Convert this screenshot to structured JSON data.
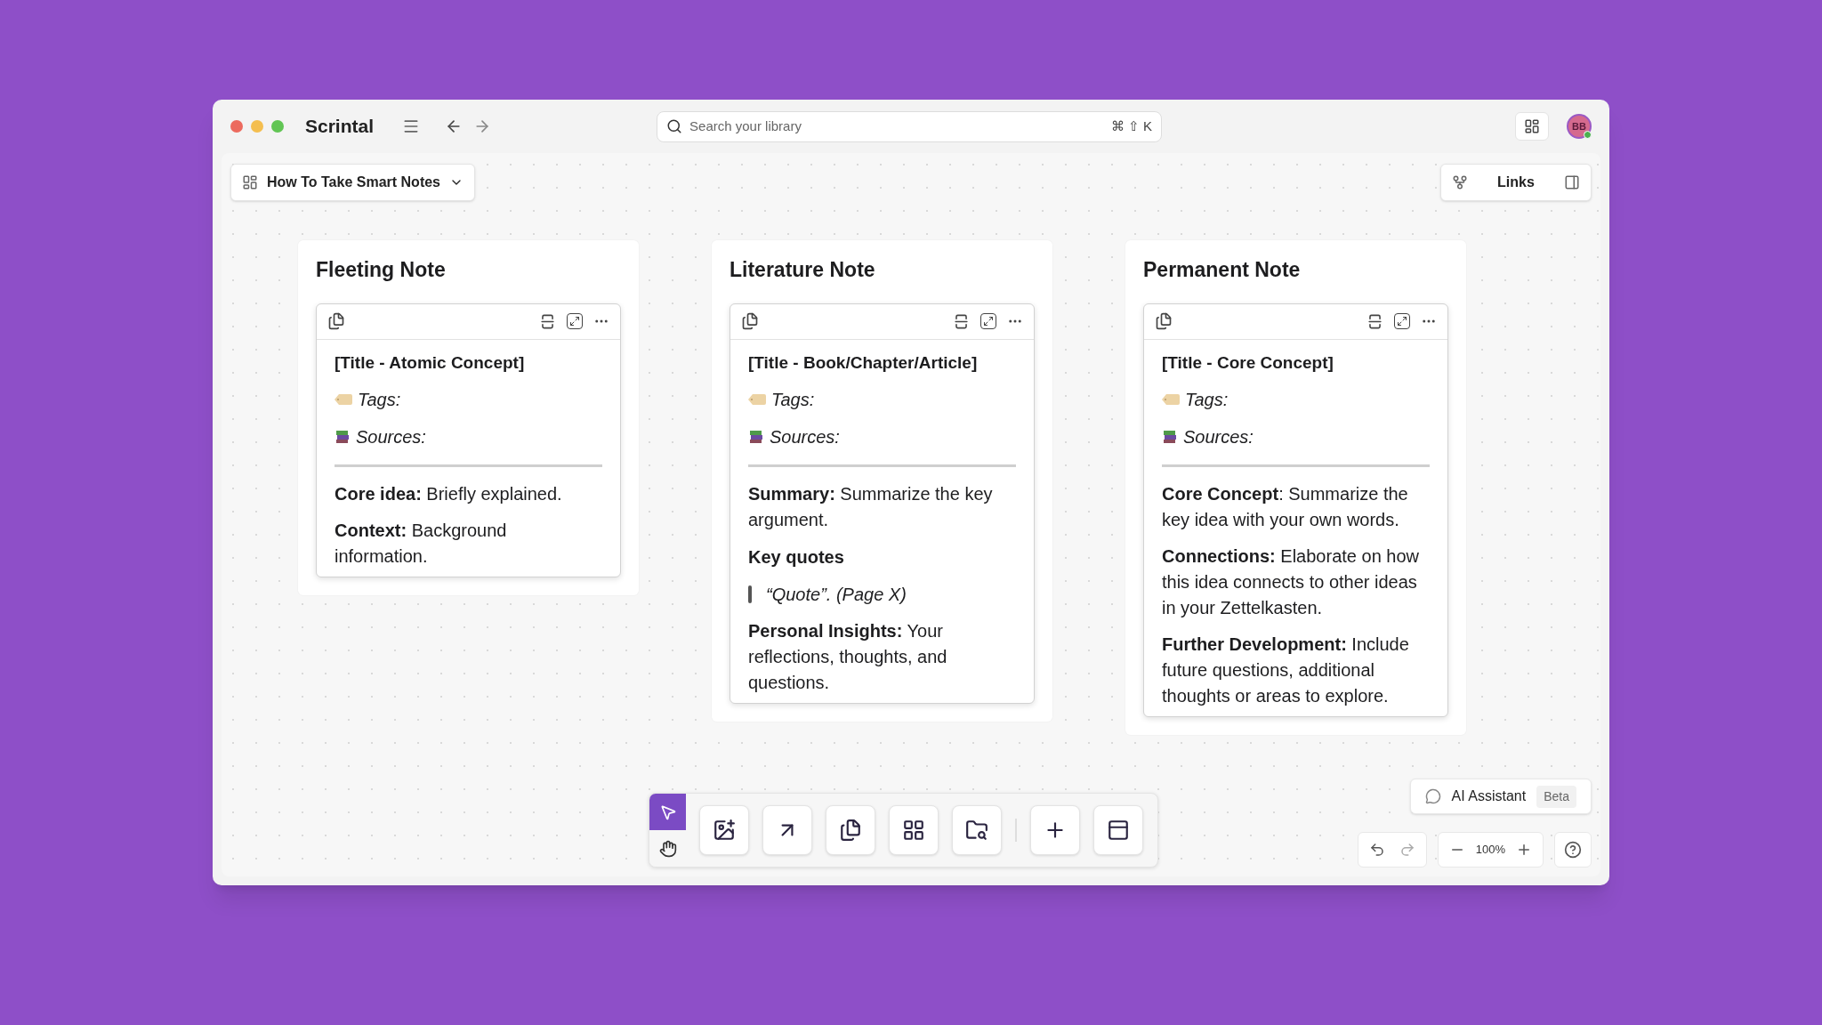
{
  "app": {
    "title": "Scrintal"
  },
  "search": {
    "placeholder": "Search your library",
    "shortcut": "⌘ ⇧ K"
  },
  "user": {
    "initials": "BB"
  },
  "board": {
    "name": "How To Take Smart Notes"
  },
  "links_panel": {
    "label": "Links"
  },
  "columns": [
    {
      "title": "Fleeting Note",
      "card": {
        "blocks": [
          {
            "kind": "title",
            "text": "[Title - Atomic Concept]"
          },
          {
            "kind": "tags",
            "text": "Tags:"
          },
          {
            "kind": "sources",
            "text": "Sources:"
          },
          {
            "kind": "paragraph",
            "text": "**Core idea:** Briefly explained."
          },
          {
            "kind": "paragraph",
            "text": "**Context:** Background information."
          }
        ]
      }
    },
    {
      "title": "Literature Note",
      "card": {
        "blocks": [
          {
            "kind": "title",
            "text": "[Title - Book/Chapter/Article]"
          },
          {
            "kind": "tags",
            "text": "Tags:"
          },
          {
            "kind": "sources",
            "text": "Sources:"
          },
          {
            "kind": "paragraph",
            "text": "**Summary:** Summarize the key argument."
          },
          {
            "kind": "heading",
            "text": "Key quotes"
          },
          {
            "kind": "quote",
            "text": "“Quote”. (Page X)"
          },
          {
            "kind": "paragraph",
            "text": "**Personal Insights:** Your reflections, thoughts, and questions."
          }
        ]
      }
    },
    {
      "title": "Permanent Note",
      "card": {
        "blocks": [
          {
            "kind": "title",
            "text": "[Title - Core Concept]"
          },
          {
            "kind": "tags",
            "text": "Tags:"
          },
          {
            "kind": "sources",
            "text": "Sources:"
          },
          {
            "kind": "paragraph",
            "text": "**Core Concept**: Summarize the key idea with your own words."
          },
          {
            "kind": "paragraph",
            "text": "**Connections:** Elaborate on how this idea connects to other ideas in your Zettelkasten."
          },
          {
            "kind": "paragraph",
            "text": "**Further Development:** Include future questions, additional thoughts or areas to explore."
          }
        ]
      }
    }
  ],
  "modes": [
    {
      "kind": "select",
      "selected": true
    },
    {
      "kind": "hand",
      "selected": false
    }
  ],
  "assistant": {
    "label": "AI Assistant",
    "badge": "Beta"
  },
  "zoom": {
    "value": "100%"
  }
}
